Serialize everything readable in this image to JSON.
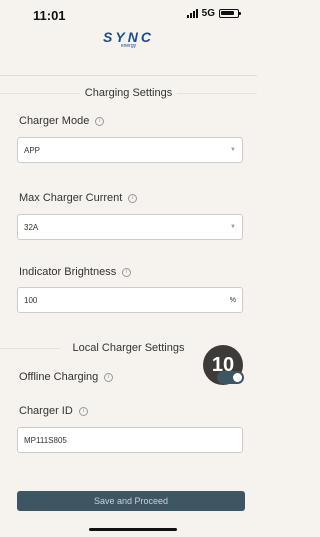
{
  "status": {
    "time": "11:01",
    "network": "5G"
  },
  "logo": {
    "word": "SYNC",
    "sub": "energy"
  },
  "charging_settings": {
    "title": "Charging Settings"
  },
  "charger_mode": {
    "label": "Charger Mode",
    "value": "APP"
  },
  "max_current": {
    "label": "Max Charger Current",
    "value": "32A"
  },
  "indicator_brightness": {
    "label": "Indicator Brightness",
    "value": "100",
    "unit": "%"
  },
  "local_settings": {
    "title": "Local Charger Settings",
    "badge": "10"
  },
  "offline_charging": {
    "label": "Offline Charging",
    "enabled": true
  },
  "charger_id": {
    "label": "Charger ID",
    "value": "MP111S805"
  },
  "save_button": {
    "label": "Save and Proceed"
  },
  "colors": {
    "accent": "#3e5663",
    "background": "#f6f3ee",
    "logo": "#1b4d8a"
  },
  "icons": {
    "info": "info-icon",
    "dropdown": "chevron-down-icon"
  }
}
